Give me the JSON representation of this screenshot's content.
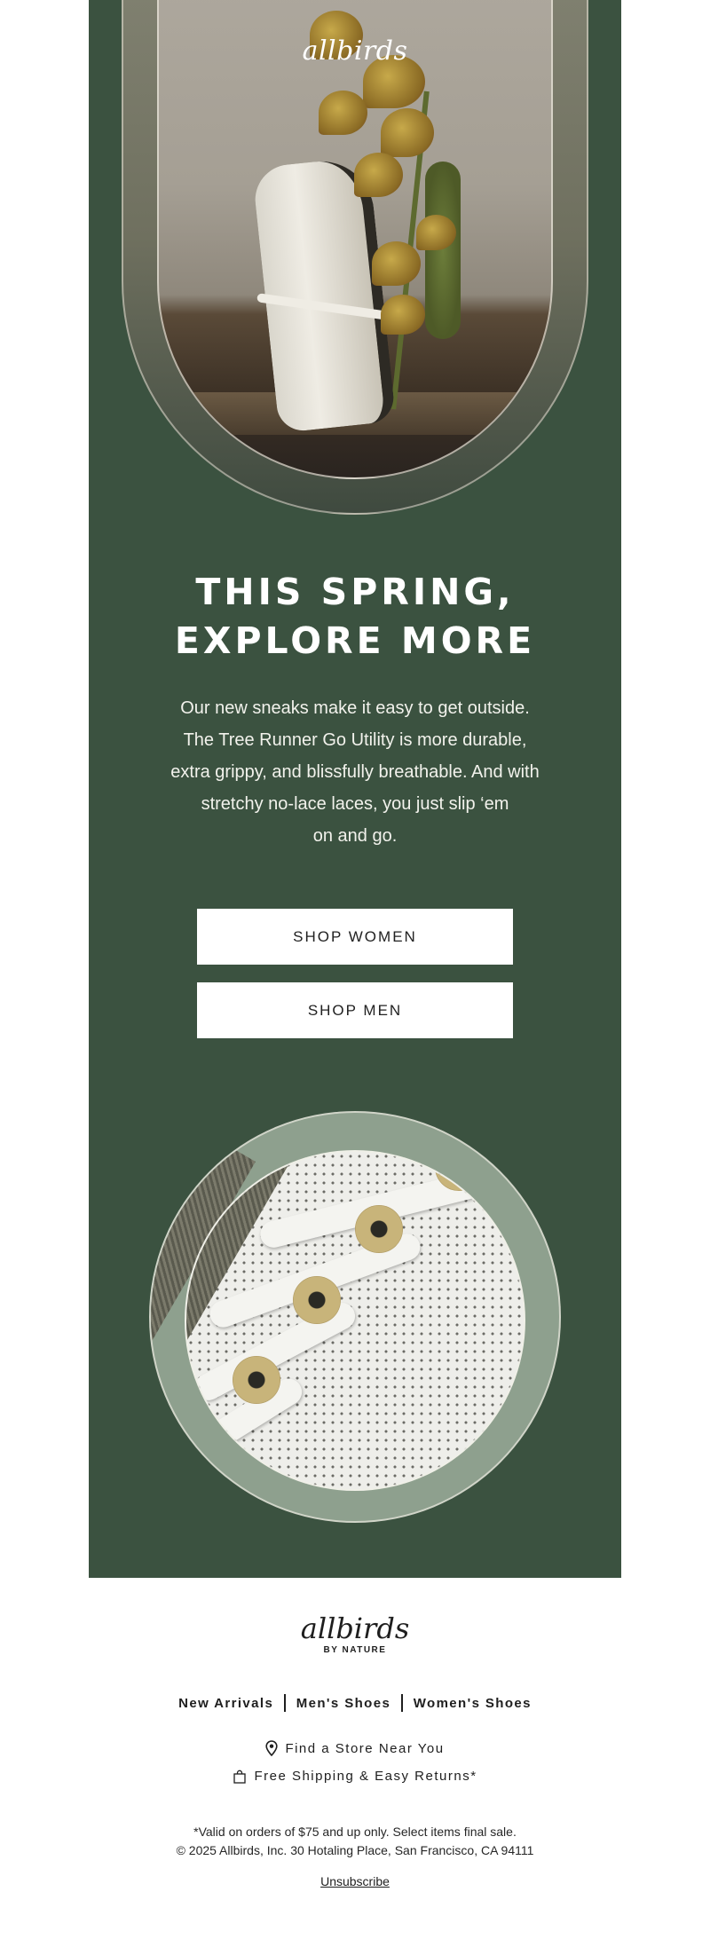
{
  "hero": {
    "logo_text": "allbirds"
  },
  "headline": {
    "line1": "THIS SPRING,",
    "line2": "EXPLORE MORE"
  },
  "body_copy": {
    "line1": "Our new sneaks make it easy to get outside.",
    "line2": "The Tree Runner Go Utility is more durable,",
    "line3": "extra grippy, and blissfully breathable. And with",
    "line4": "stretchy no-lace laces, you just slip ‘em",
    "line5": "on and go."
  },
  "buttons": {
    "shop_women": "SHOP WOMEN",
    "shop_men": "SHOP MEN"
  },
  "footer": {
    "logo_text": "allbirds",
    "tagline": "BY NATURE",
    "nav": [
      "New Arrivals",
      "Men's Shoes",
      "Women's Shoes"
    ],
    "store_link": "Find a Store Near You",
    "shipping_text": "Free Shipping & Easy Returns*",
    "legal_line1": "*Valid on orders of $75 and up only. Select items final sale.",
    "legal_line2": "© 2025 Allbirds, Inc. 30 Hotaling Place, San Francisco, CA 94111",
    "unsubscribe": "Unsubscribe"
  },
  "colors": {
    "brand_green": "#3b5240",
    "button_bg": "#ffffff",
    "text_dark": "#1e1e1e"
  },
  "icons": {
    "store": "map-pin-icon",
    "shipping": "shopping-bag-icon"
  }
}
